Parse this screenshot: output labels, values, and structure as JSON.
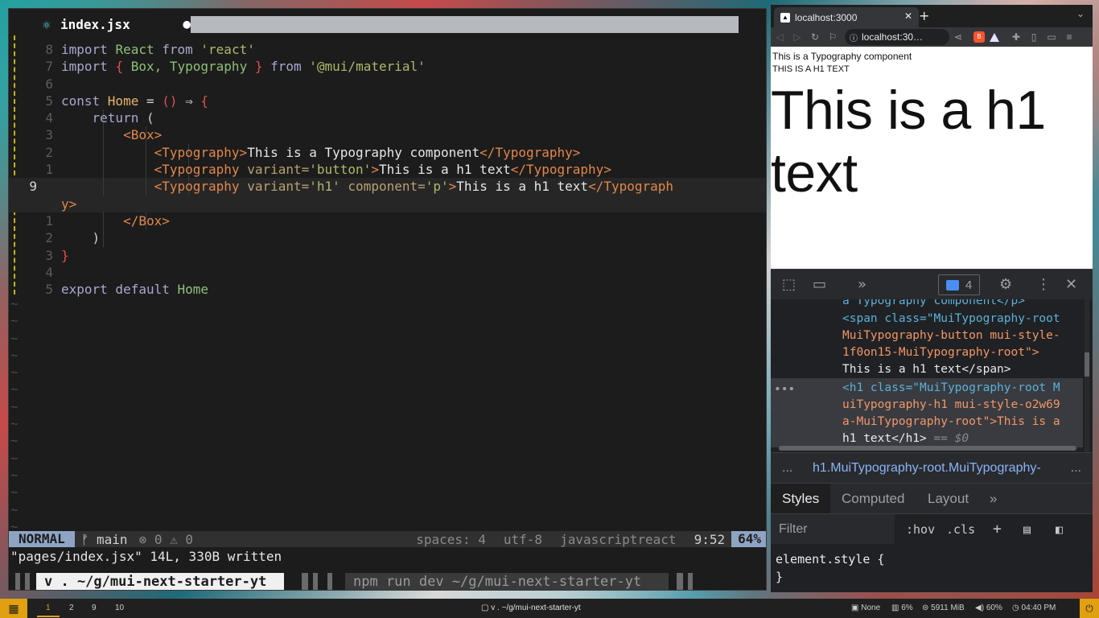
{
  "editor": {
    "tab": {
      "filename": "index.jsx",
      "modified_dot": "●",
      "close": "✖"
    },
    "lines": [
      {
        "num": "8",
        "tokens": [
          [
            "kw",
            "import "
          ],
          [
            "id",
            "React "
          ],
          [
            "kw",
            "from "
          ],
          [
            "str",
            "'react'"
          ]
        ]
      },
      {
        "num": "7",
        "tokens": [
          [
            "kw",
            "import "
          ],
          [
            "brace",
            "{ "
          ],
          [
            "id",
            "Box, Typography "
          ],
          [
            "brace",
            "} "
          ],
          [
            "kw",
            "from "
          ],
          [
            "str",
            "'@mui/material'"
          ]
        ]
      },
      {
        "num": "6",
        "tokens": []
      },
      {
        "num": "5",
        "tokens": [
          [
            "kw",
            "const "
          ],
          [
            "fn",
            "Home "
          ],
          [
            "op",
            "= "
          ],
          [
            "brace",
            "() "
          ],
          [
            "op",
            "⇒ "
          ],
          [
            "brace",
            "{"
          ]
        ]
      },
      {
        "num": "4",
        "tokens": [
          [
            "pad",
            "    "
          ],
          [
            "kw",
            "return "
          ],
          [
            "op",
            "("
          ]
        ]
      },
      {
        "num": "3",
        "tokens": [
          [
            "pad",
            "        "
          ],
          [
            "tag",
            "<Box>"
          ]
        ]
      },
      {
        "num": "2",
        "tokens": [
          [
            "pad",
            "            "
          ],
          [
            "tag",
            "<Typography>"
          ],
          [
            "plain",
            "This is a Typography component"
          ],
          [
            "tag",
            "</Typography>"
          ]
        ]
      },
      {
        "num": "1",
        "tokens": [
          [
            "pad",
            "            "
          ],
          [
            "tag",
            "<Typography "
          ],
          [
            "attr",
            "variant="
          ],
          [
            "str",
            "'button'"
          ],
          [
            "tag",
            ">"
          ],
          [
            "plain",
            "This is a h1 text"
          ],
          [
            "tag",
            "</Typography>"
          ]
        ]
      },
      {
        "num": "9",
        "current": true,
        "tokens": [
          [
            "pad",
            "            "
          ],
          [
            "tag",
            "<Typography "
          ],
          [
            "attr",
            "variant="
          ],
          [
            "str",
            "'h1' "
          ],
          [
            "attr",
            "component="
          ],
          [
            "str",
            "'p'"
          ],
          [
            "tag",
            ">"
          ],
          [
            "plain",
            "This is a h1 text"
          ],
          [
            "tag",
            "</Typograph"
          ]
        ]
      },
      {
        "num": "",
        "current_wrap": true,
        "tokens": [
          [
            "tag",
            "y>"
          ]
        ]
      },
      {
        "num": "1",
        "tokens": [
          [
            "pad",
            "        "
          ],
          [
            "tag",
            "</Box>"
          ]
        ]
      },
      {
        "num": "2",
        "tokens": [
          [
            "pad",
            "    "
          ],
          [
            "op",
            ")"
          ]
        ]
      },
      {
        "num": "3",
        "tokens": [
          [
            "brace",
            "}"
          ]
        ]
      },
      {
        "num": "4",
        "tokens": []
      },
      {
        "num": "5",
        "tokens": [
          [
            "kw",
            "export default "
          ],
          [
            "id",
            "Home"
          ]
        ]
      }
    ],
    "tilde_count": 14,
    "status": {
      "mode": "NORMAL",
      "branch": "main",
      "errors": "0",
      "warnings": "0",
      "spaces": "spaces: 4",
      "encoding": "utf-8",
      "filetype": "javascriptreact",
      "position": "9:52",
      "percent": "64%"
    },
    "cmdline": "\"pages/index.jsx\" 14L, 330B written",
    "tmux": {
      "active": "v . ~/g/mui-next-starter-yt",
      "inactive": "npm run dev ~/g/mui-next-starter-yt"
    }
  },
  "browser": {
    "tab_title": "localhost:3000",
    "tab_close": "✕",
    "new_tab": "+",
    "url": "localhost:30…",
    "page": {
      "body_text": "This is a Typography component",
      "button_text": "THIS IS A H1 TEXT",
      "h1_text": "This is a h1 text"
    },
    "devtools": {
      "badge_count": "4",
      "elements": {
        "partial_top": "a Typography component</p>",
        "span_open": "<span class=\"MuiTypography-root",
        "span_line2": "MuiTypography-button mui-style-",
        "span_line3": "1f0on15-MuiTypography-root\">",
        "span_text": "This is a h1 text</span>",
        "h1_line1": "<h1 class=\"MuiTypography-root M",
        "h1_line2": "uiTypography-h1 mui-style-o2w69",
        "h1_line3": "a-MuiTypography-root\">This is a",
        "h1_line4": "h1 text</h1> == $0"
      },
      "breadcrumb": "h1.MuiTypography-root.MuiTypography-",
      "style_tabs": [
        "Styles",
        "Computed",
        "Layout"
      ],
      "filter_placeholder": "Filter",
      "hov": ":hov",
      "cls": ".cls",
      "element_style_open": "element.style {",
      "element_style_close": "}"
    }
  },
  "panel": {
    "workspaces": [
      "1",
      "2",
      "9",
      "10"
    ],
    "task": "v . ~/g/mui-next-starter-yt",
    "none": "None",
    "cpu": "6%",
    "mem": "5911 MiB",
    "volume": "60%",
    "clock": "04:40 PM"
  }
}
